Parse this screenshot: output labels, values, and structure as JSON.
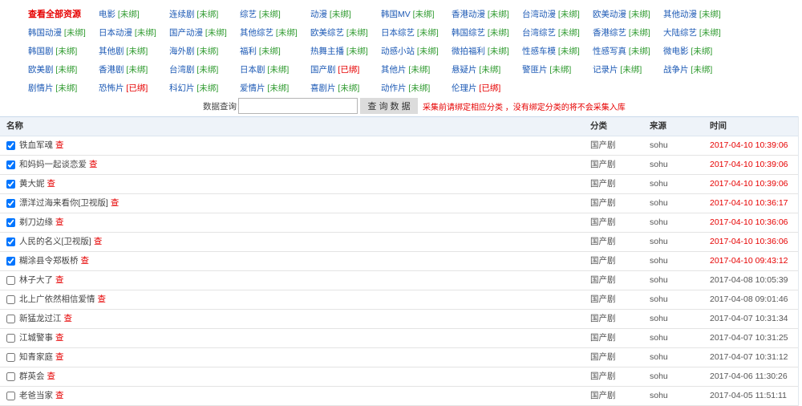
{
  "colors": {
    "accent_red": "#e60000",
    "link_blue": "#1d5ab5",
    "unbound_green": "#2f9a2f",
    "header_bg": "#eef3f9"
  },
  "categories": {
    "view_all": "查看全部资源",
    "items": [
      {
        "name": "电影",
        "status": "[未绑]",
        "bound": false
      },
      {
        "name": "连续剧",
        "status": "[未绑]",
        "bound": false
      },
      {
        "name": "综艺",
        "status": "[未绑]",
        "bound": false
      },
      {
        "name": "动漫",
        "status": "[未绑]",
        "bound": false
      },
      {
        "name": "韩国MV",
        "status": "[未绑]",
        "bound": false
      },
      {
        "name": "香港动漫",
        "status": "[未绑]",
        "bound": false
      },
      {
        "name": "台湾动漫",
        "status": "[未绑]",
        "bound": false
      },
      {
        "name": "欧美动漫",
        "status": "[未绑]",
        "bound": false
      },
      {
        "name": "其他动漫",
        "status": "[未绑]",
        "bound": false
      },
      {
        "name": "韩国动漫",
        "status": "[未绑]",
        "bound": false
      },
      {
        "name": "日本动漫",
        "status": "[未绑]",
        "bound": false
      },
      {
        "name": "国产动漫",
        "status": "[未绑]",
        "bound": false
      },
      {
        "name": "其他综艺",
        "status": "[未绑]",
        "bound": false
      },
      {
        "name": "欧美综艺",
        "status": "[未绑]",
        "bound": false
      },
      {
        "name": "日本综艺",
        "status": "[未绑]",
        "bound": false
      },
      {
        "name": "韩国综艺",
        "status": "[未绑]",
        "bound": false
      },
      {
        "name": "台湾综艺",
        "status": "[未绑]",
        "bound": false
      },
      {
        "name": "香港综艺",
        "status": "[未绑]",
        "bound": false
      },
      {
        "name": "大陆综艺",
        "status": "[未绑]",
        "bound": false
      },
      {
        "name": "韩国剧",
        "status": "[未绑]",
        "bound": false
      },
      {
        "name": "其他剧",
        "status": "[未绑]",
        "bound": false
      },
      {
        "name": "海外剧",
        "status": "[未绑]",
        "bound": false
      },
      {
        "name": "福利",
        "status": "[未绑]",
        "bound": false
      },
      {
        "name": "热舞主播",
        "status": "[未绑]",
        "bound": false
      },
      {
        "name": "动感小站",
        "status": "[未绑]",
        "bound": false
      },
      {
        "name": "微拍福利",
        "status": "[未绑]",
        "bound": false
      },
      {
        "name": "性感车模",
        "status": "[未绑]",
        "bound": false
      },
      {
        "name": "性感写真",
        "status": "[未绑]",
        "bound": false
      },
      {
        "name": "微电影",
        "status": "[未绑]",
        "bound": false
      },
      {
        "name": "欧美剧",
        "status": "[未绑]",
        "bound": false
      },
      {
        "name": "香港剧",
        "status": "[未绑]",
        "bound": false
      },
      {
        "name": "台湾剧",
        "status": "[未绑]",
        "bound": false
      },
      {
        "name": "日本剧",
        "status": "[未绑]",
        "bound": false
      },
      {
        "name": "国产剧",
        "status": "[已绑]",
        "bound": true
      },
      {
        "name": "其他片",
        "status": "[未绑]",
        "bound": false
      },
      {
        "name": "悬疑片",
        "status": "[未绑]",
        "bound": false
      },
      {
        "name": "警匪片",
        "status": "[未绑]",
        "bound": false
      },
      {
        "name": "记录片",
        "status": "[未绑]",
        "bound": false
      },
      {
        "name": "战争片",
        "status": "[未绑]",
        "bound": false
      },
      {
        "name": "剧情片",
        "status": "[未绑]",
        "bound": false
      },
      {
        "name": "恐怖片",
        "status": "[已绑]",
        "bound": true
      },
      {
        "name": "科幻片",
        "status": "[未绑]",
        "bound": false
      },
      {
        "name": "爱情片",
        "status": "[未绑]",
        "bound": false
      },
      {
        "name": "喜剧片",
        "status": "[未绑]",
        "bound": false
      },
      {
        "name": "动作片",
        "status": "[未绑]",
        "bound": false
      },
      {
        "name": "伦理片",
        "status": "[已绑]",
        "bound": true
      }
    ]
  },
  "search": {
    "label": "数据查询：",
    "button": "查 询 数 据",
    "note": "采集前请绑定相应分类 ，没有绑定分类的将不会采集入库"
  },
  "table": {
    "headers": {
      "name": "名称",
      "category": "分类",
      "source": "来源",
      "time": "时间"
    },
    "view_label": "查",
    "rows": [
      {
        "checked": true,
        "title": "铁血军魂",
        "category": "国产剧",
        "source": "sohu",
        "time": "2017-04-10 10:39:06",
        "time_highlight": true
      },
      {
        "checked": true,
        "title": "和妈妈一起谈恋爱",
        "category": "国产剧",
        "source": "sohu",
        "time": "2017-04-10 10:39:06",
        "time_highlight": true
      },
      {
        "checked": true,
        "title": "黄大妮",
        "category": "国产剧",
        "source": "sohu",
        "time": "2017-04-10 10:39:06",
        "time_highlight": true
      },
      {
        "checked": true,
        "title": "漂洋过海来看你[卫视版]",
        "category": "国产剧",
        "source": "sohu",
        "time": "2017-04-10 10:36:17",
        "time_highlight": true
      },
      {
        "checked": true,
        "title": "剃刀边缘",
        "category": "国产剧",
        "source": "sohu",
        "time": "2017-04-10 10:36:06",
        "time_highlight": true
      },
      {
        "checked": true,
        "title": "人民的名义[卫视版]",
        "category": "国产剧",
        "source": "sohu",
        "time": "2017-04-10 10:36:06",
        "time_highlight": true
      },
      {
        "checked": true,
        "title": "糊涂县令郑板桥",
        "category": "国产剧",
        "source": "sohu",
        "time": "2017-04-10 09:43:12",
        "time_highlight": true
      },
      {
        "checked": false,
        "title": "林子大了",
        "category": "国产剧",
        "source": "sohu",
        "time": "2017-04-08 10:05:39",
        "time_highlight": false
      },
      {
        "checked": false,
        "title": "北上广依然相信爱情",
        "category": "国产剧",
        "source": "sohu",
        "time": "2017-04-08 09:01:46",
        "time_highlight": false
      },
      {
        "checked": false,
        "title": "新猛龙过江",
        "category": "国产剧",
        "source": "sohu",
        "time": "2017-04-07 10:31:34",
        "time_highlight": false
      },
      {
        "checked": false,
        "title": "江城警事",
        "category": "国产剧",
        "source": "sohu",
        "time": "2017-04-07 10:31:25",
        "time_highlight": false
      },
      {
        "checked": false,
        "title": "知青家庭",
        "category": "国产剧",
        "source": "sohu",
        "time": "2017-04-07 10:31:12",
        "time_highlight": false
      },
      {
        "checked": false,
        "title": "群英会",
        "category": "国产剧",
        "source": "sohu",
        "time": "2017-04-06 11:30:26",
        "time_highlight": false
      },
      {
        "checked": false,
        "title": "老爸当家",
        "category": "国产剧",
        "source": "sohu",
        "time": "2017-04-05 11:51:11",
        "time_highlight": false
      }
    ]
  }
}
